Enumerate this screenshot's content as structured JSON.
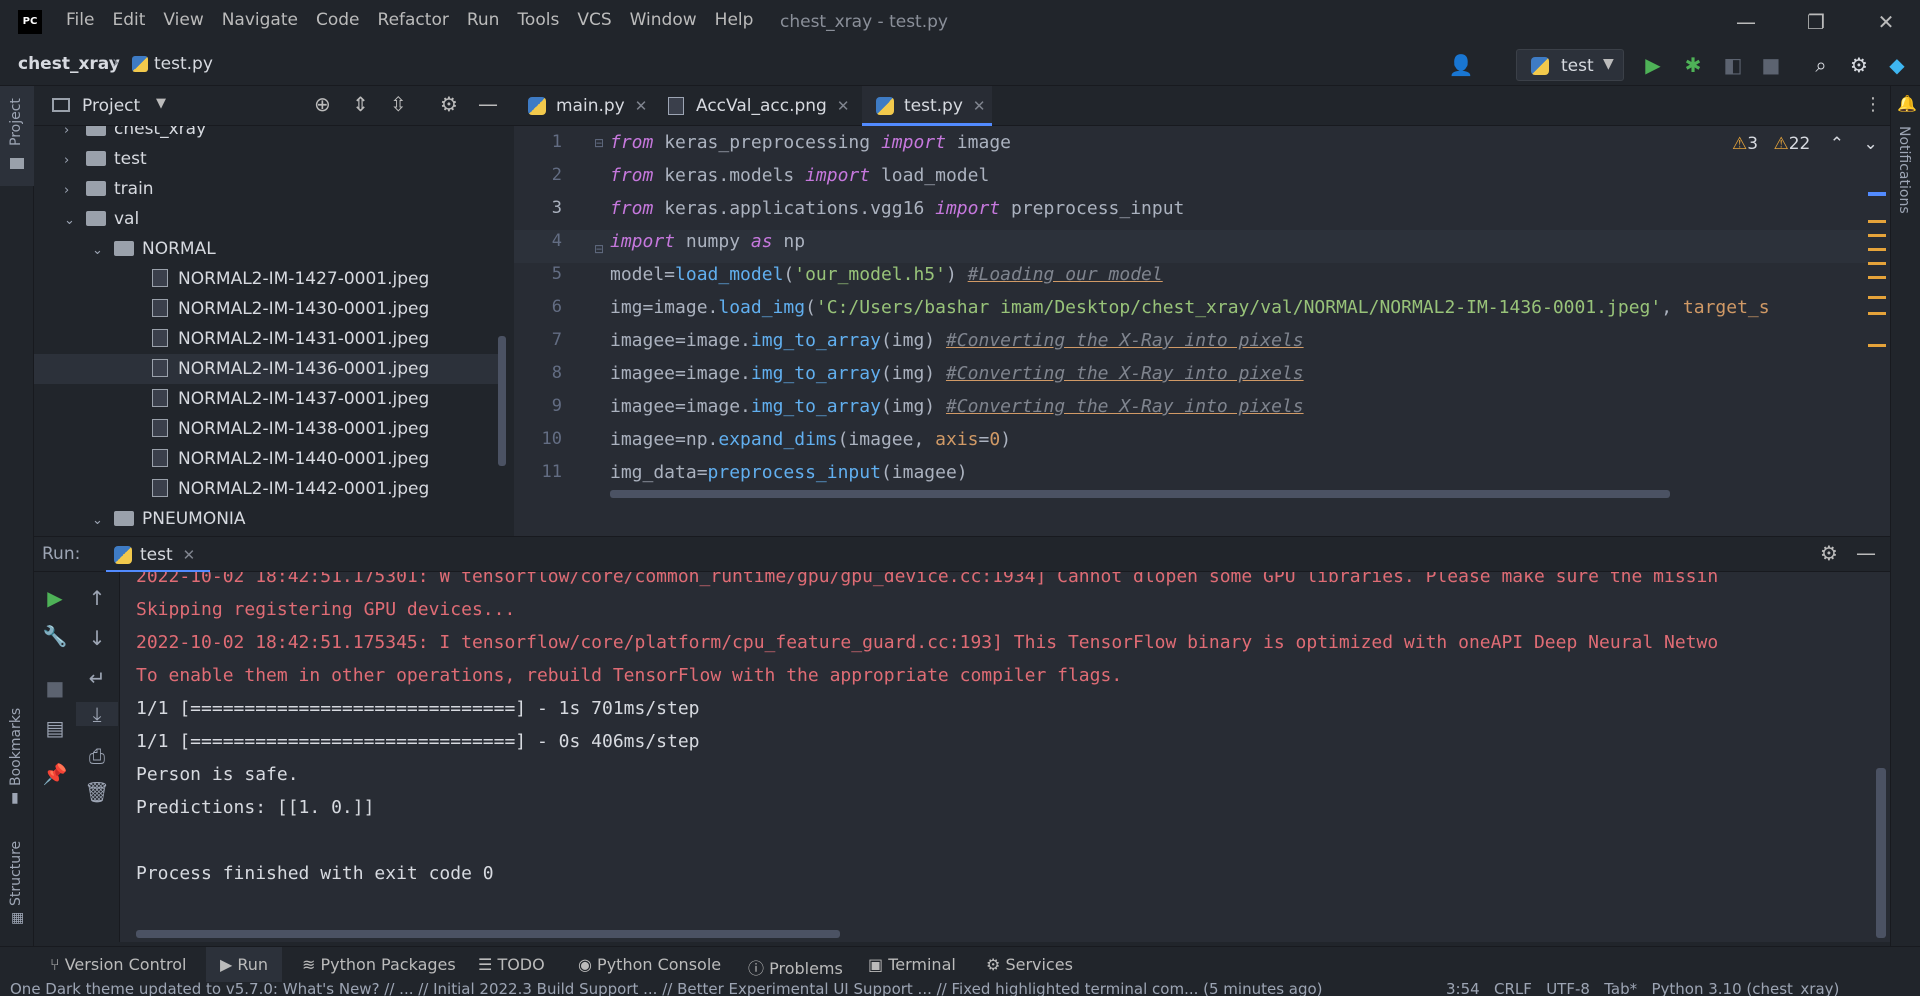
{
  "titlebar": {
    "logo_text": "PC",
    "menu": [
      "File",
      "Edit",
      "View",
      "Navigate",
      "Code",
      "Refactor",
      "Run",
      "Tools",
      "VCS",
      "Window",
      "Help"
    ],
    "window_title": "chest_xray - test.py"
  },
  "navbar": {
    "project": "chest_xray",
    "file": "test.py",
    "run_config": "test"
  },
  "left_strip": {
    "project": "Project",
    "bookmarks": "Bookmarks",
    "structure": "Structure"
  },
  "right_strip": {
    "notifications": "Notifications"
  },
  "project_panel": {
    "title": "Project",
    "items": [
      {
        "label": "chest_xray",
        "kind": "folder",
        "arrow": "›"
      },
      {
        "label": "test",
        "kind": "folder",
        "arrow": "›"
      },
      {
        "label": "train",
        "kind": "folder",
        "arrow": "›"
      },
      {
        "label": "val",
        "kind": "folder",
        "arrow": "⌄"
      },
      {
        "label": "NORMAL",
        "kind": "folder",
        "arrow": "⌄"
      },
      {
        "label": "NORMAL2-IM-1427-0001.jpeg",
        "kind": "file"
      },
      {
        "label": "NORMAL2-IM-1430-0001.jpeg",
        "kind": "file"
      },
      {
        "label": "NORMAL2-IM-1431-0001.jpeg",
        "kind": "file"
      },
      {
        "label": "NORMAL2-IM-1436-0001.jpeg",
        "kind": "file",
        "selected": true
      },
      {
        "label": "NORMAL2-IM-1437-0001.jpeg",
        "kind": "file"
      },
      {
        "label": "NORMAL2-IM-1438-0001.jpeg",
        "kind": "file"
      },
      {
        "label": "NORMAL2-IM-1440-0001.jpeg",
        "kind": "file"
      },
      {
        "label": "NORMAL2-IM-1442-0001.jpeg",
        "kind": "file"
      },
      {
        "label": "PNEUMONIA",
        "kind": "folder",
        "arrow": "⌄"
      }
    ]
  },
  "editor": {
    "tabs": [
      {
        "label": "main.py",
        "icon": "python"
      },
      {
        "label": "AccVal_acc.png",
        "icon": "image"
      },
      {
        "label": "test.py",
        "icon": "python",
        "active": true
      }
    ],
    "warnings": {
      "weak": "3",
      "strong": "22"
    },
    "line_numbers": [
      "1",
      "2",
      "3",
      "4",
      "5",
      "6",
      "7",
      "8",
      "9",
      "10",
      "11"
    ],
    "lines": [
      [
        {
          "t": "from",
          "c": "kw"
        },
        {
          "t": " keras_preprocessing ",
          "c": ""
        },
        {
          "t": "import",
          "c": "kw"
        },
        {
          "t": " image",
          "c": ""
        }
      ],
      [
        {
          "t": "from",
          "c": "kw"
        },
        {
          "t": " keras.models ",
          "c": ""
        },
        {
          "t": "import",
          "c": "kw"
        },
        {
          "t": " load_model",
          "c": ""
        }
      ],
      [
        {
          "t": "from",
          "c": "kw"
        },
        {
          "t": " keras.applications.vgg16 ",
          "c": ""
        },
        {
          "t": "import",
          "c": "kw"
        },
        {
          "t": " preprocess_input",
          "c": ""
        }
      ],
      [
        {
          "t": "import",
          "c": "kw"
        },
        {
          "t": " numpy ",
          "c": ""
        },
        {
          "t": "as",
          "c": "kw"
        },
        {
          "t": " np",
          "c": ""
        }
      ],
      [
        {
          "t": "model=",
          "c": ""
        },
        {
          "t": "load_model",
          "c": "fn"
        },
        {
          "t": "(",
          "c": ""
        },
        {
          "t": "'our_model.h5'",
          "c": "st"
        },
        {
          "t": ") ",
          "c": ""
        },
        {
          "t": "#Loading our model",
          "c": "cm"
        }
      ],
      [
        {
          "t": "img=image.",
          "c": ""
        },
        {
          "t": "load_img",
          "c": "fn"
        },
        {
          "t": "(",
          "c": ""
        },
        {
          "t": "'C:/Users/bashar imam/Desktop/chest_xray/val/NORMAL/NORMAL2-IM-1436-0001.jpeg'",
          "c": "st"
        },
        {
          "t": ", ",
          "c": ""
        },
        {
          "t": "target_s",
          "c": "pr"
        }
      ],
      [
        {
          "t": "imagee=image.",
          "c": ""
        },
        {
          "t": "img_to_array",
          "c": "fn"
        },
        {
          "t": "(img) ",
          "c": ""
        },
        {
          "t": "#Converting the X-Ray into pixels",
          "c": "cm"
        }
      ],
      [
        {
          "t": "imagee=image.",
          "c": ""
        },
        {
          "t": "img_to_array",
          "c": "fn"
        },
        {
          "t": "(img) ",
          "c": ""
        },
        {
          "t": "#Converting the X-Ray into pixels",
          "c": "cm"
        }
      ],
      [
        {
          "t": "imagee=image.",
          "c": ""
        },
        {
          "t": "img_to_array",
          "c": "fn"
        },
        {
          "t": "(img) ",
          "c": ""
        },
        {
          "t": "#Converting the X-Ray into pixels",
          "c": "cm"
        }
      ],
      [
        {
          "t": "imagee=np.",
          "c": ""
        },
        {
          "t": "expand_dims",
          "c": "fn"
        },
        {
          "t": "(imagee, ",
          "c": ""
        },
        {
          "t": "axis",
          "c": "pr"
        },
        {
          "t": "=",
          "c": ""
        },
        {
          "t": "0",
          "c": "pr"
        },
        {
          "t": ")",
          "c": ""
        }
      ],
      [
        {
          "t": "img_data=",
          "c": ""
        },
        {
          "t": "preprocess_input",
          "c": "fn"
        },
        {
          "t": "(imagee)",
          "c": ""
        }
      ]
    ]
  },
  "run_panel": {
    "label": "Run:",
    "tab": "test",
    "output": [
      {
        "text": "2022-10-02 18:42:51.175301: W tensorflow/core/common_runtime/gpu/gpu_device.cc:1934] Cannot dlopen some GPU libraries. Please make sure the missin",
        "err": true
      },
      {
        "text": "Skipping registering GPU devices...",
        "err": true
      },
      {
        "text": "2022-10-02 18:42:51.175345: I tensorflow/core/platform/cpu_feature_guard.cc:193] This TensorFlow binary is optimized with oneAPI Deep Neural Netwo",
        "err": true
      },
      {
        "text": "To enable them in other operations, rebuild TensorFlow with the appropriate compiler flags.",
        "err": true
      },
      {
        "text": "1/1 [==============================] - 1s 701ms/step",
        "err": false
      },
      {
        "text": "1/1 [==============================] - 0s 406ms/step",
        "err": false
      },
      {
        "text": "Person is safe.",
        "err": false
      },
      {
        "text": "Predictions: [[1. 0.]]",
        "err": false
      },
      {
        "text": "",
        "err": false
      },
      {
        "text": "Process finished with exit code 0",
        "err": false
      }
    ]
  },
  "bottom_tabs": [
    "Version Control",
    "Run",
    "Python Packages",
    "TODO",
    "Python Console",
    "Problems",
    "Terminal",
    "Services"
  ],
  "status": {
    "message": "One Dark theme updated to v5.7.0: What's New? // ... // Initial 2022.3 Build Support ... // Better Experimental UI Support ... // Fixed highlighted terminal com... (5 minutes ago)",
    "position": "3:54",
    "line_sep": "CRLF",
    "encoding": "UTF-8",
    "indent": "Tab*",
    "interpreter": "Python 3.10 (chest_xray)"
  },
  "colors": {
    "accent": "#528bff",
    "keyword": "#c678dd",
    "function": "#61afef",
    "string": "#98c379",
    "error": "#e06c75",
    "run_green": "#4eb257",
    "warning": "#e5a33a"
  }
}
